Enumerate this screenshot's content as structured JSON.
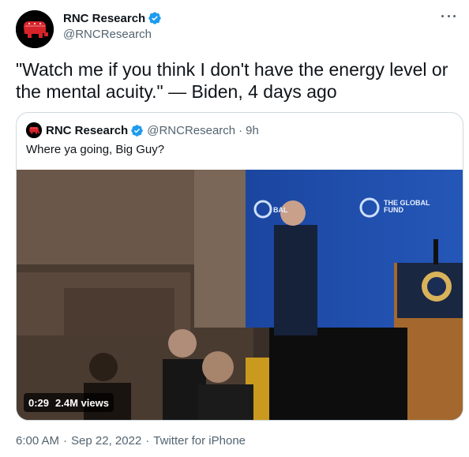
{
  "author": {
    "name": "RNC Research",
    "handle": "@RNCResearch"
  },
  "tweet": {
    "text": "\"Watch me if you think I don't have the energy level or the mental acuity.\" — Biden, 4 days ago"
  },
  "quoted": {
    "name": "RNC Research",
    "handle": "@RNCResearch",
    "separator": "·",
    "time": "9h",
    "text": "Where ya going, Big Guy?",
    "video": {
      "duration": "0:29",
      "views": "2.4M views",
      "backdrop_text": "THE GLOBAL FUND",
      "backdrop_partial": "BAL"
    }
  },
  "footer": {
    "time": "6:00 AM",
    "date": "Sep 22, 2022",
    "source": "Twitter for iPhone",
    "separator": "·"
  },
  "icons": {
    "avatar": "republican-elephant-icon",
    "verified": "verified-badge-icon",
    "more": "more-options-icon"
  },
  "colors": {
    "verified": "#1d9bf0",
    "elephant": "#d6242a",
    "secondary_text": "#536471",
    "border": "#cfd9de"
  }
}
